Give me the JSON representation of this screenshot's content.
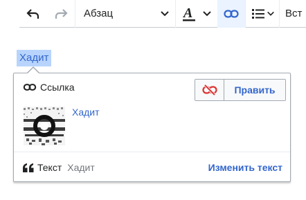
{
  "toolbar": {
    "undo_icon": "undo-icon",
    "redo_icon": "redo-icon",
    "format_label": "Абзац",
    "style_icon": "text-style-icon",
    "link_icon": "link-icon",
    "list_icon": "bulleted-list-icon",
    "insert_label": "Вст"
  },
  "selection": {
    "text": "Хадит"
  },
  "popup": {
    "title": "Ссылка",
    "unlink_icon": "unlink-icon",
    "edit_label": "Править",
    "page_title": "Хадит",
    "footer": {
      "label": "Текст",
      "value": "Хадит",
      "change_label": "Изменить текст"
    }
  },
  "colors": {
    "accent": "#3366cc",
    "highlight": "#b8d4fc",
    "destructive": "#d33"
  }
}
